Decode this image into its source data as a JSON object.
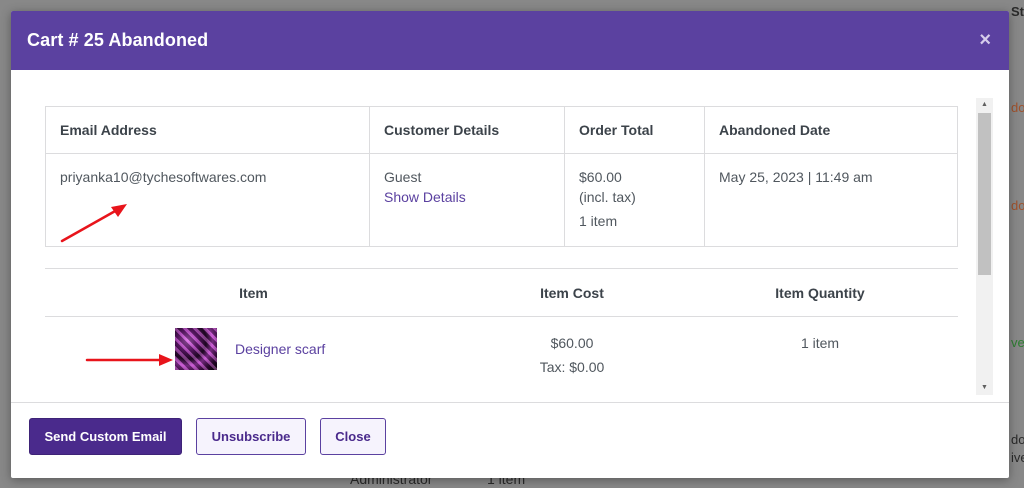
{
  "modal": {
    "title": "Cart # 25  Abandoned",
    "close_glyph": "×"
  },
  "summary": {
    "headers": [
      "Email Address",
      "Customer Details",
      "Order Total",
      "Abandoned Date"
    ],
    "email": "priyanka10@tychesoftwares.com",
    "customer_type": "Guest",
    "show_details_label": "Show Details",
    "order_total": "$60.00",
    "tax_note": "(incl. tax)",
    "item_count": "1 item",
    "abandoned_date": "May 25, 2023 | 11:49 am"
  },
  "items": {
    "headers": [
      "Item",
      "Item Cost",
      "Item Quantity"
    ],
    "rows": [
      {
        "name": "Designer scarf",
        "cost": "$60.00",
        "tax": "Tax: $0.00",
        "quantity": "1 item"
      }
    ]
  },
  "footer": {
    "send_email_label": "Send Custom Email",
    "unsubscribe_label": "Unsubscribe",
    "close_label": "Close"
  },
  "background": {
    "right_fragments": [
      "St",
      "do",
      "do",
      "ve",
      "do",
      "ive"
    ],
    "bottom_left": "Administrator",
    "bottom_right": "1 item"
  },
  "colors": {
    "header_bg": "#5b41a0",
    "primary_button": "#4a2a8c",
    "link": "#5b41a0",
    "arrow": "#e8141b"
  },
  "icons": {
    "close": "close-icon",
    "scroll_up": "scroll-up-arrow-icon",
    "scroll_down": "scroll-down-arrow-icon"
  }
}
